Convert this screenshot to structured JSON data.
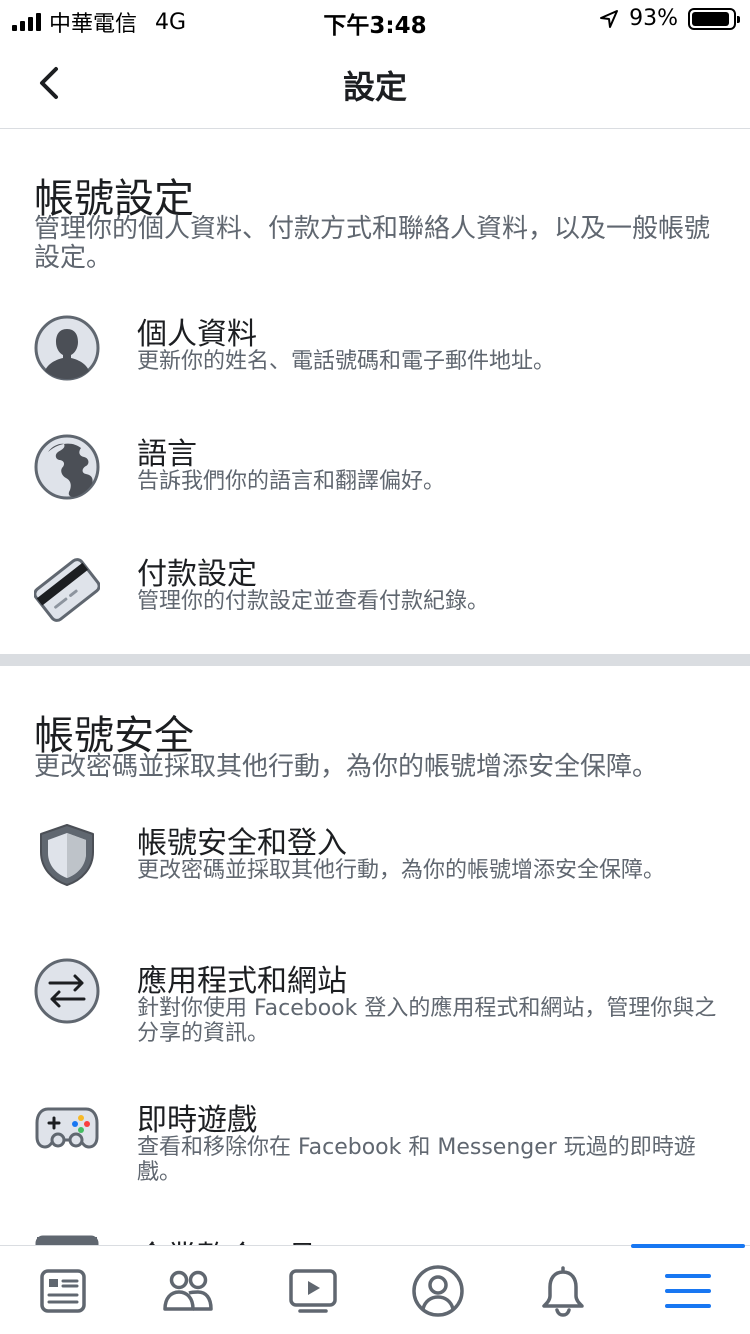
{
  "status_bar": {
    "carrier": "中華電信",
    "network": "4G",
    "time": "下午3:48",
    "battery_percent": "93%",
    "battery_level": 0.93
  },
  "nav": {
    "title": "設定",
    "back_icon": "chevron-left-icon"
  },
  "account_settings": {
    "title": "帳號設定",
    "description": "管理你的個人資料、付款方式和聯絡人資料，以及一般帳號設定。",
    "items": [
      {
        "icon": "profile-icon",
        "title": "個人資料",
        "description": "更新你的姓名、電話號碼和電子郵件地址。"
      },
      {
        "icon": "globe-icon",
        "title": "語言",
        "description": "告訴我們你的語言和翻譯偏好。"
      },
      {
        "icon": "credit-card-icon",
        "title": "付款設定",
        "description": "管理你的付款設定並查看付款紀錄。"
      }
    ]
  },
  "account_security": {
    "title": "帳號安全",
    "description": "更改密碼並採取其他行動，為你的帳號增添安全保障。",
    "items": [
      {
        "icon": "shield-icon",
        "title": "帳號安全和登入",
        "description": "更改密碼並採取其他行動，為你的帳號增添安全保障。"
      },
      {
        "icon": "swap-arrows-icon",
        "title": "應用程式和網站",
        "description": "針對你使用 Facebook 登入的應用程式和網站，管理你與之分享的資訊。"
      },
      {
        "icon": "gamepad-icon",
        "title": "即時遊戲",
        "description": "查看和移除你在 Facebook 和 Messenger 玩過的即時遊戲。"
      },
      {
        "icon": "business-tools-icon",
        "title": "企業整合工具",
        "description": ""
      }
    ]
  },
  "tab_bar": {
    "tabs": [
      {
        "icon": "news-feed-icon",
        "active": false
      },
      {
        "icon": "friends-icon",
        "active": false
      },
      {
        "icon": "watch-icon",
        "active": false
      },
      {
        "icon": "profile-circle-icon",
        "active": false
      },
      {
        "icon": "bell-icon",
        "active": false
      },
      {
        "icon": "menu-icon",
        "active": true
      }
    ]
  },
  "colors": {
    "accent": "#1877f2",
    "text_primary": "#1c1e21",
    "text_secondary": "#606770",
    "icon_fill": "#dfe3ea",
    "icon_stroke": "#606770",
    "divider": "#dadde1"
  }
}
